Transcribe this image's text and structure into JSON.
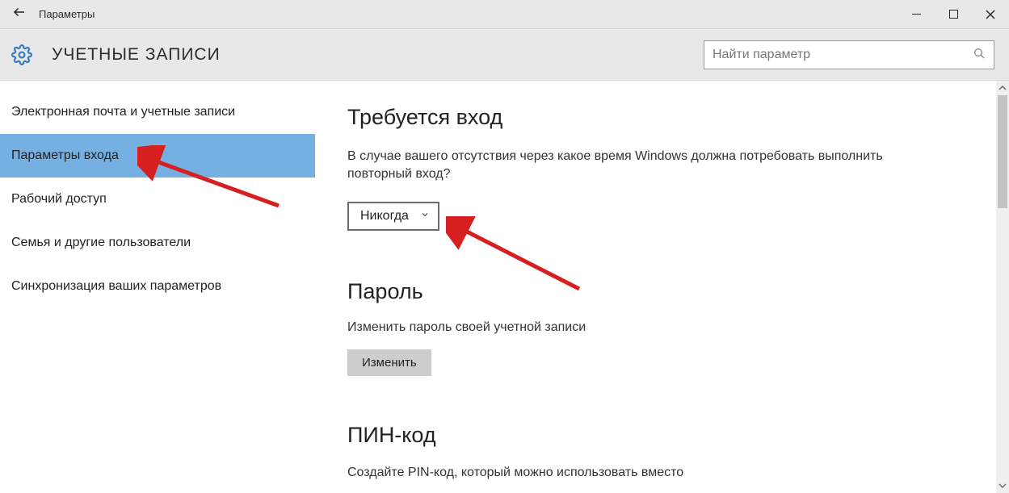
{
  "titlebar": {
    "title": "Параметры"
  },
  "header": {
    "section_title": "УЧЕТНЫЕ ЗАПИСИ",
    "search_placeholder": "Найти параметр"
  },
  "sidebar": {
    "items": [
      {
        "label": "Электронная почта и учетные записи",
        "selected": false
      },
      {
        "label": "Параметры входа",
        "selected": true
      },
      {
        "label": "Рабочий доступ",
        "selected": false
      },
      {
        "label": "Семья и другие пользователи",
        "selected": false
      },
      {
        "label": "Синхронизация ваших параметров",
        "selected": false
      }
    ]
  },
  "content": {
    "signin": {
      "heading": "Требуется вход",
      "description": "В случае вашего отсутствия через какое время Windows должна потребовать выполнить повторный вход?",
      "dropdown_value": "Никогда"
    },
    "password": {
      "heading": "Пароль",
      "description": "Изменить пароль своей учетной записи",
      "button": "Изменить"
    },
    "pin": {
      "heading": "ПИН-код",
      "truncated_text": "Создайте PIN-код, который можно использовать вместо"
    }
  }
}
